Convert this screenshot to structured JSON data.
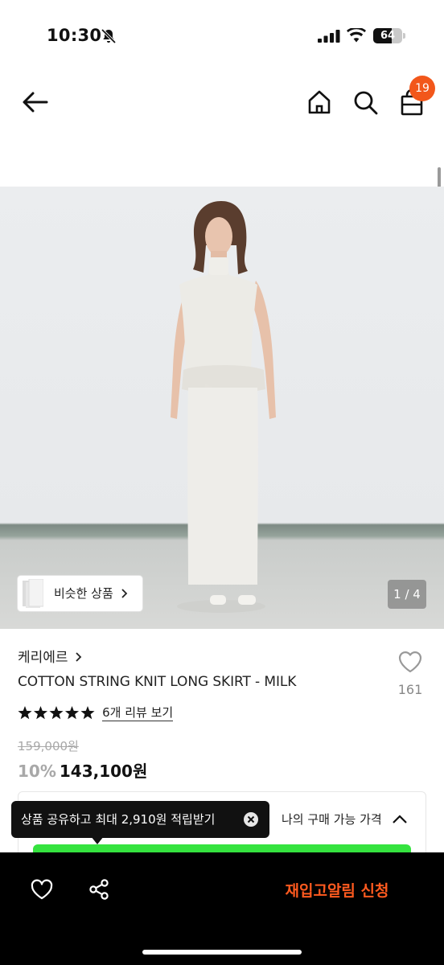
{
  "status_bar": {
    "time": "10:30",
    "battery": "64",
    "battery_level": 0.64
  },
  "header": {
    "cart_count": "19",
    "icons": [
      "back-arrow-icon",
      "home-icon",
      "search-icon",
      "shopping-bag-icon"
    ]
  },
  "gallery": {
    "similar_label": "비슷한 상품",
    "page_counter": "1 / 4"
  },
  "product": {
    "brand": "케리에르",
    "title": "COTTON STRING KNIT LONG SKIRT - MILK",
    "wish_count": "161",
    "rating": 5,
    "review_link": "6개 리뷰 보기",
    "original_price": "159,000원",
    "discount": "10%",
    "sale_price": "143,100원"
  },
  "my_price": {
    "label": "나의 구매 가능 가격"
  },
  "tooltip": {
    "text": "상품 공유하고 최대 2,910원 적립받기"
  },
  "bottom_bar": {
    "restock_label": "재입고알림 신청"
  },
  "colors": {
    "accent": "#f2571b",
    "restock": "#ff5a1f",
    "green_bar": "#35e33f"
  }
}
